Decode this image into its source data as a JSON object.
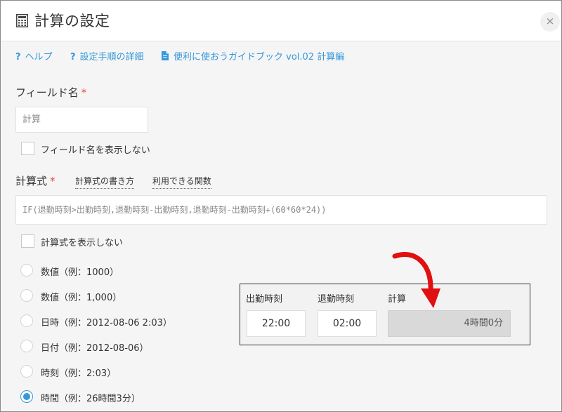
{
  "dialog": {
    "title": "計算の設定",
    "close_symbol": "×"
  },
  "help_links": {
    "help": "ヘルプ",
    "setup_steps": "設定手順の詳細",
    "guidebook": "便利に使おうガイドブック vol.02 計算編"
  },
  "field_name": {
    "label": "フィールド名",
    "required_mark": "*",
    "value": "計算",
    "hide_checkbox_label": "フィールド名を表示しない"
  },
  "formula": {
    "label": "計算式",
    "required_mark": "*",
    "how_to_write": "計算式の書き方",
    "functions": "利用できる関数",
    "value": "IF(退勤時刻>出勤時刻,退勤時刻-出勤時刻,退勤時刻-出勤時刻+(60*60*24))",
    "hide_checkbox_label": "計算式を表示しない"
  },
  "format_options": [
    {
      "label": "数値（例：1000）",
      "selected": false
    },
    {
      "label": "数値（例：1,000）",
      "selected": false
    },
    {
      "label": "日時（例：2012-08-06 2:03）",
      "selected": false
    },
    {
      "label": "日付（例：2012-08-06）",
      "selected": false
    },
    {
      "label": "時刻（例：2:03）",
      "selected": false
    },
    {
      "label": "時間（例：26時間3分）",
      "selected": true
    }
  ],
  "example_panel": {
    "start_label": "出勤時刻",
    "start_value": "22:00",
    "end_label": "退勤時刻",
    "end_value": "02:00",
    "calc_label": "計算",
    "calc_value": "4時間0分"
  },
  "colors": {
    "accent": "#3498db",
    "required": "#e74c3c",
    "arrow": "#e01010"
  }
}
